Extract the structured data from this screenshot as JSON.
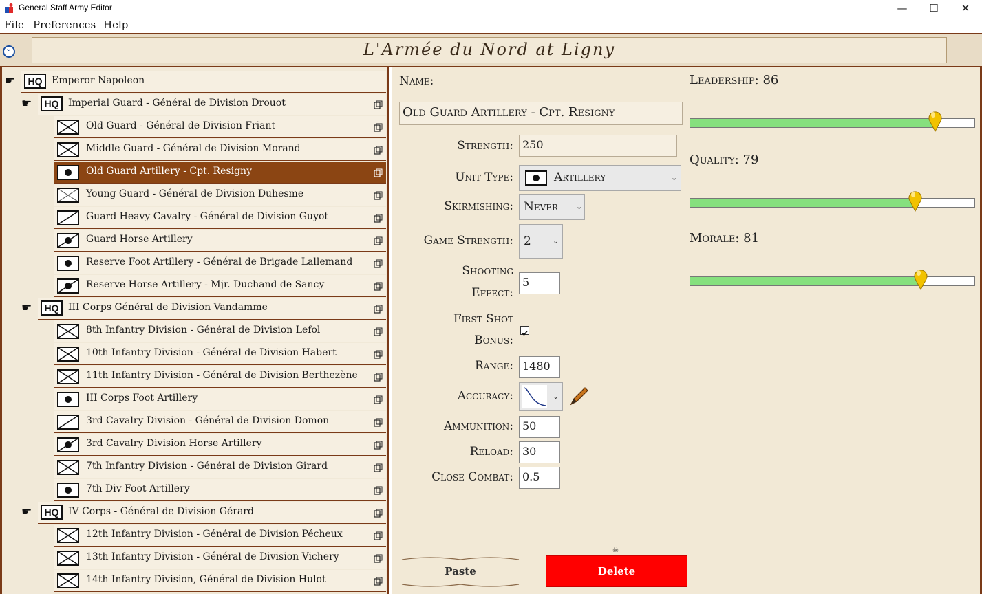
{
  "window": {
    "title": "General Staff Army Editor"
  },
  "menu": {
    "file": "File",
    "preferences": "Preferences",
    "help": "Help"
  },
  "header": {
    "scenario_title": "L'Armée du Nord at Ligny"
  },
  "tree": {
    "hq_label": "HQ",
    "rows": [
      {
        "label": "Emperor Napoleon",
        "kind": "hq",
        "level": 0
      },
      {
        "label": "Imperial Guard - Général de Division Drouot",
        "kind": "hq",
        "level": 1
      },
      {
        "label": "Old Guard - Général de Division Friant",
        "kind": "infantry",
        "level": 2
      },
      {
        "label": "Middle Guard - Général de Division Morand",
        "kind": "infantry",
        "level": 2
      },
      {
        "label": "Old Guard Artillery - Cpt. Resigny",
        "kind": "artillery",
        "level": 2,
        "selected": true
      },
      {
        "label": "Young Guard - Général de Division Duhesme",
        "kind": "light-infantry",
        "level": 2
      },
      {
        "label": "Guard Heavy Cavalry - Général de Division Guyot",
        "kind": "cavalry",
        "level": 2
      },
      {
        "label": "Guard Horse Artillery",
        "kind": "horse-artillery",
        "level": 2
      },
      {
        "label": "Reserve Foot Artillery -  Général de Brigade Lallemand",
        "kind": "artillery",
        "level": 2
      },
      {
        "label": "Reserve Horse Artillery - Mjr. Duchand de Sancy",
        "kind": "horse-artillery",
        "level": 2
      },
      {
        "label": "III Corps Général de Division Vandamme",
        "kind": "hq",
        "level": 1
      },
      {
        "label": "8th Infantry Division - Général de Division Lefol",
        "kind": "infantry",
        "level": 2
      },
      {
        "label": "10th Infantry Division - Général de Division Habert",
        "kind": "infantry",
        "level": 2
      },
      {
        "label": "11th Infantry Division - Général de Division Berthezène",
        "kind": "infantry",
        "level": 2
      },
      {
        "label": "III Corps Foot Artillery",
        "kind": "artillery",
        "level": 2
      },
      {
        "label": "3rd Cavalry Division - Général de Division Domon",
        "kind": "cavalry",
        "level": 2
      },
      {
        "label": "3rd Cavalry Division Horse Artillery",
        "kind": "horse-artillery",
        "level": 2
      },
      {
        "label": "7th Infantry Division - Général de Division Girard",
        "kind": "infantry",
        "level": 2
      },
      {
        "label": "7th Div Foot Artillery",
        "kind": "artillery",
        "level": 2
      },
      {
        "label": "IV Corps - Général de Division Gérard",
        "kind": "hq",
        "level": 1
      },
      {
        "label": "12th Infantry Division -  Général de Division Pécheux",
        "kind": "infantry",
        "level": 2
      },
      {
        "label": "13th Infantry Division -  Général de Division Vichery",
        "kind": "infantry",
        "level": 2
      },
      {
        "label": "14th Infantry Division,  Général de Division Hulot",
        "kind": "infantry",
        "level": 2
      }
    ]
  },
  "detail": {
    "name_label": "Name:",
    "name_value": "Old Guard Artillery - Cpt. Resigny",
    "strength_label": "Strength:",
    "strength_value": "250",
    "unit_type_label": "Unit Type:",
    "unit_type_value": "Artillery",
    "skirmishing_label": "Skirmishing:",
    "skirmishing_value": "Never",
    "game_strength_label": "Game Strength:",
    "game_strength_value": "2",
    "shooting_effect_label_1": "Shooting",
    "shooting_effect_label_2": "Effect:",
    "shooting_effect_value": "5",
    "first_shot_label_1": "First Shot",
    "first_shot_label_2": "Bonus:",
    "first_shot_checked": true,
    "range_label": "Range:",
    "range_value": "1480",
    "accuracy_label": "Accuracy:",
    "ammunition_label": "Ammunition:",
    "ammunition_value": "50",
    "reload_label": "Reload:",
    "reload_value": "30",
    "close_combat_label": "Close Combat:",
    "close_combat_value": "0.5"
  },
  "sliders": [
    {
      "key": "leadership",
      "label": "Leadership: 86",
      "value": 86
    },
    {
      "key": "quality",
      "label": "Quality: 79",
      "value": 79
    },
    {
      "key": "morale",
      "label": "Morale: 81",
      "value": 81
    }
  ],
  "actions": {
    "paste": "Paste",
    "delete": "Delete"
  },
  "colors": {
    "border": "#7a3a18",
    "selected": "#8b4513",
    "parchment": "#f2e9d6",
    "slider_fill": "#86e07e",
    "delete": "#ff0000"
  }
}
